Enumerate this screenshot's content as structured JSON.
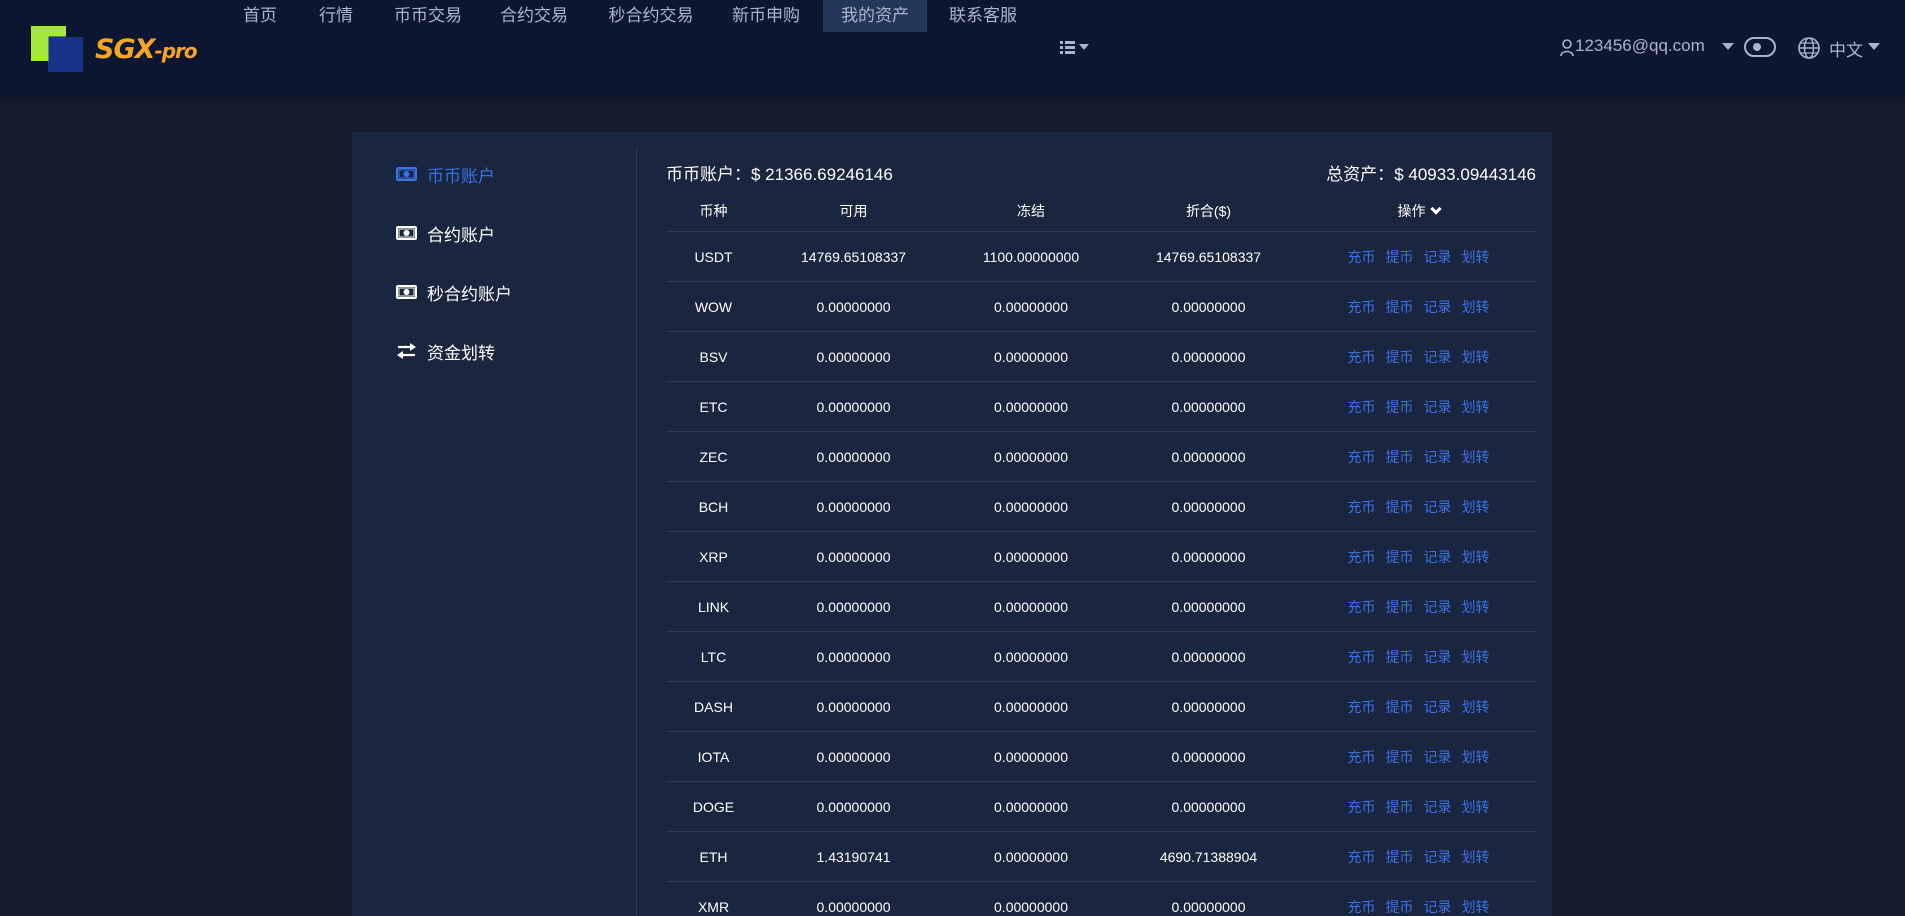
{
  "header": {
    "logo_text": "SGX",
    "logo_suffix": "-pro",
    "nav": [
      {
        "label": "首页"
      },
      {
        "label": "行情"
      },
      {
        "label": "币币交易"
      },
      {
        "label": "合约交易"
      },
      {
        "label": "秒合约交易"
      },
      {
        "label": "新币申购"
      },
      {
        "label": "我的资产",
        "active": true
      },
      {
        "label": "联系客服"
      }
    ],
    "user_email": "123456@qq.com",
    "language": "中文"
  },
  "sidebar": {
    "items": [
      {
        "label": "币币账户",
        "icon": "money-icon",
        "active": true
      },
      {
        "label": "合约账户",
        "icon": "money-icon"
      },
      {
        "label": "秒合约账户",
        "icon": "money-icon"
      },
      {
        "label": "资金划转",
        "icon": "transfer-icon"
      }
    ]
  },
  "summary": {
    "account_label": "币币账户：",
    "account_value": "$ 21366.69246146",
    "total_label": "总资产：",
    "total_value": "$ 40933.09443146"
  },
  "table": {
    "headers": [
      "币种",
      "可用",
      "冻结",
      "折合($)",
      "操作"
    ],
    "actions": [
      "充币",
      "提币",
      "记录",
      "划转"
    ],
    "rows": [
      {
        "coin": "USDT",
        "available": "14769.65108337",
        "frozen": "1100.00000000",
        "value": "14769.65108337"
      },
      {
        "coin": "WOW",
        "available": "0.00000000",
        "frozen": "0.00000000",
        "value": "0.00000000"
      },
      {
        "coin": "BSV",
        "available": "0.00000000",
        "frozen": "0.00000000",
        "value": "0.00000000"
      },
      {
        "coin": "ETC",
        "available": "0.00000000",
        "frozen": "0.00000000",
        "value": "0.00000000"
      },
      {
        "coin": "ZEC",
        "available": "0.00000000",
        "frozen": "0.00000000",
        "value": "0.00000000"
      },
      {
        "coin": "BCH",
        "available": "0.00000000",
        "frozen": "0.00000000",
        "value": "0.00000000"
      },
      {
        "coin": "XRP",
        "available": "0.00000000",
        "frozen": "0.00000000",
        "value": "0.00000000"
      },
      {
        "coin": "LINK",
        "available": "0.00000000",
        "frozen": "0.00000000",
        "value": "0.00000000"
      },
      {
        "coin": "LTC",
        "available": "0.00000000",
        "frozen": "0.00000000",
        "value": "0.00000000"
      },
      {
        "coin": "DASH",
        "available": "0.00000000",
        "frozen": "0.00000000",
        "value": "0.00000000"
      },
      {
        "coin": "IOTA",
        "available": "0.00000000",
        "frozen": "0.00000000",
        "value": "0.00000000"
      },
      {
        "coin": "DOGE",
        "available": "0.00000000",
        "frozen": "0.00000000",
        "value": "0.00000000"
      },
      {
        "coin": "ETH",
        "available": "1.43190741",
        "frozen": "0.00000000",
        "value": "4690.71388904"
      },
      {
        "coin": "XMR",
        "available": "0.00000000",
        "frozen": "0.00000000",
        "value": "0.00000000"
      }
    ]
  }
}
